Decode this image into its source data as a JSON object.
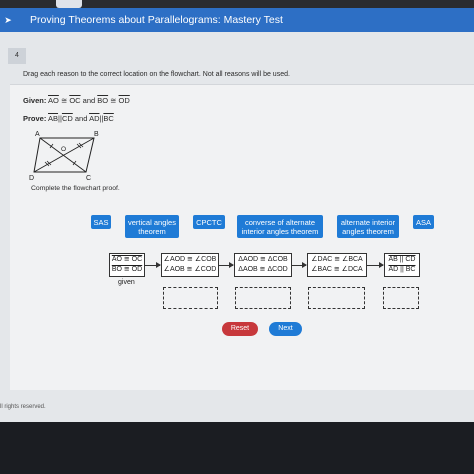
{
  "header": {
    "title": "Proving Theorems about Parallelograms: Mastery Test"
  },
  "question": {
    "number": "4",
    "instruction": "Drag each reason to the correct location on the flowchart. Not all reasons will be used.",
    "given_label": "Given:",
    "given_a": "AO",
    "given_cong1": " ≅ ",
    "given_b": "OC",
    "given_and": " and ",
    "given_c": "BO",
    "given_cong2": " ≅ ",
    "given_d": "OD",
    "prove_label": "Prove:",
    "prove_a": "AB",
    "prove_par1": "||",
    "prove_b": "CD",
    "prove_and": " and ",
    "prove_c": "AD",
    "prove_par2": "||",
    "prove_d": "BC",
    "complete_text": "Complete the flowchart proof."
  },
  "diagram": {
    "labels": {
      "a": "A",
      "b": "B",
      "c": "C",
      "d": "D",
      "o": "O"
    }
  },
  "reasons": {
    "sas": "SAS",
    "vertical_angles": "vertical angles theorem",
    "cpctc": "CPCTC",
    "converse_alt_interior": "converse of alternate interior angles theorem",
    "alt_interior": "alternate interior angles theorem",
    "asa": "ASA"
  },
  "flowchart": {
    "box1": {
      "line1": "AO ≅ OC",
      "line2": "BO ≅ OD",
      "reason": "given"
    },
    "box2": {
      "line1": "∠AOD ≅ ∠COB",
      "line2": "∠AOB ≅ ∠COD"
    },
    "box3": {
      "line1": "ΔAOD ≅ ΔCOB",
      "line2": "ΔAOB ≅ ΔCOD"
    },
    "box4": {
      "line1": "∠DAC ≅ ∠BCA",
      "line2": "∠BAC ≅ ∠DCA"
    },
    "box5": {
      "line1": "AB || CD",
      "line2": "AD || BC"
    }
  },
  "buttons": {
    "reset": "Reset",
    "next": "Next"
  },
  "footer": {
    "text": "ll rights reserved."
  },
  "colors": {
    "header": "#2d6fc5",
    "chip": "#1f7bd6",
    "reset": "#c7383b",
    "next": "#1f7bd6"
  }
}
